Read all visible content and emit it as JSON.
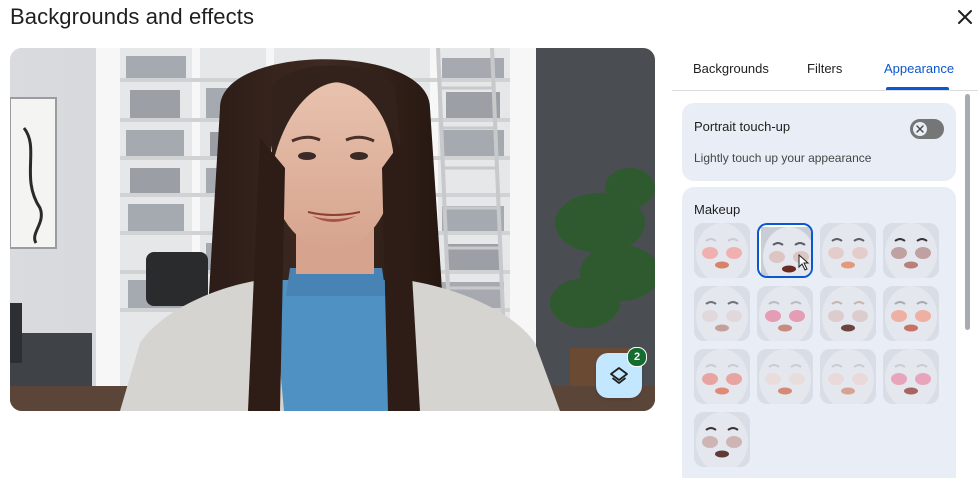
{
  "dialog": {
    "title": "Backgrounds and effects"
  },
  "icons": {
    "close": "close-icon",
    "layers": "layers-icon",
    "toggle_off": "x-icon",
    "cursor": "hand-pointer-icon"
  },
  "effects_button": {
    "count": "2"
  },
  "tabs": [
    {
      "label": "Backgrounds",
      "active": false
    },
    {
      "label": "Filters",
      "active": false
    },
    {
      "label": "Appearance",
      "active": true
    }
  ],
  "portrait": {
    "title": "Portrait touch-up",
    "description": "Lightly touch up your appearance",
    "enabled": false
  },
  "makeup": {
    "title": "Makeup",
    "selected_index": 1,
    "styles": [
      {
        "lip": "#d9826a",
        "blush": "#f2a2a0",
        "brow": "#c9ccd2"
      },
      {
        "lip": "#6b2a22",
        "blush": "#d9bdb8",
        "brow": "#5a5d63"
      },
      {
        "lip": "#e39a7c",
        "blush": "#e4c5c2",
        "brow": "#5c5f66"
      },
      {
        "lip": "#b88078",
        "blush": "#b69090",
        "brow": "#3b3435"
      },
      {
        "lip": "#c4a09a",
        "blush": "#e0d4d6",
        "brow": "#6f7277"
      },
      {
        "lip": "#c98a80",
        "blush": "#e58aa6",
        "brow": "#b9bcc2"
      },
      {
        "lip": "#6e4440",
        "blush": "#dbc6c5",
        "brow": "#c8b6ae"
      },
      {
        "lip": "#c77364",
        "blush": "#f0a28e",
        "brow": "#a8acb2"
      },
      {
        "lip": "#e08a74",
        "blush": "#e9948c",
        "brow": "#c9ccd2"
      },
      {
        "lip": "#d68a76",
        "blush": "#eadbd6",
        "brow": "#c9ccd2"
      },
      {
        "lip": "#d8a293",
        "blush": "#ead6d4",
        "brow": "#c9ccd2"
      },
      {
        "lip": "#a86462",
        "blush": "#e993ad",
        "brow": "#c9ccd2"
      },
      {
        "lip": "#5f3a36",
        "blush": "#c8a9a4",
        "brow": "#3c3232"
      }
    ]
  },
  "colors": {
    "accent": "#0b57d0",
    "badge": "#146c2e",
    "card": "#e9eef6",
    "fab": "#c2e7ff"
  }
}
